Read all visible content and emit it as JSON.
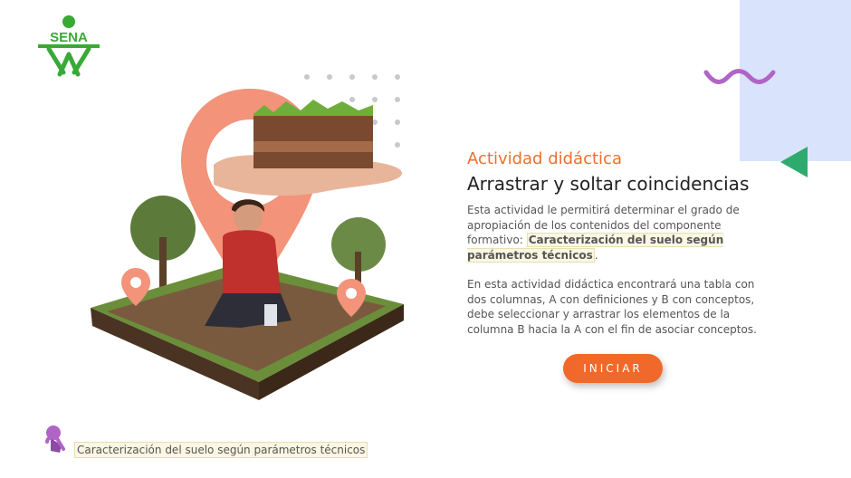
{
  "brand": {
    "logo_text": "SENA",
    "logo_color": "#39a935"
  },
  "activity": {
    "kicker": "Actividad didáctica",
    "title": "Arrastrar y soltar coincidencias",
    "intro": "Esta actividad le permitirá determinar el grado de apropiación de los contenidos del componente formativo:",
    "highlight": "Caracterización del suelo según parámetros técnicos",
    "intro_end": ".",
    "instructions": "En esta actividad didáctica encontrará una tabla con dos columnas, A con definiciones y  B con conceptos, debe seleccionar y arrastrar los elementos de la columna  B hacia la A con el fin de asociar conceptos."
  },
  "buttons": {
    "start_label": "INICIAR"
  },
  "footer": {
    "label": "Caracterización del suelo según parámetros técnicos",
    "icon": "hand-pointer-icon"
  },
  "colors": {
    "accent": "#f1692a",
    "panel": "#d9e4fc",
    "wave": "#b065c6",
    "triangle": "#2faa6e"
  }
}
